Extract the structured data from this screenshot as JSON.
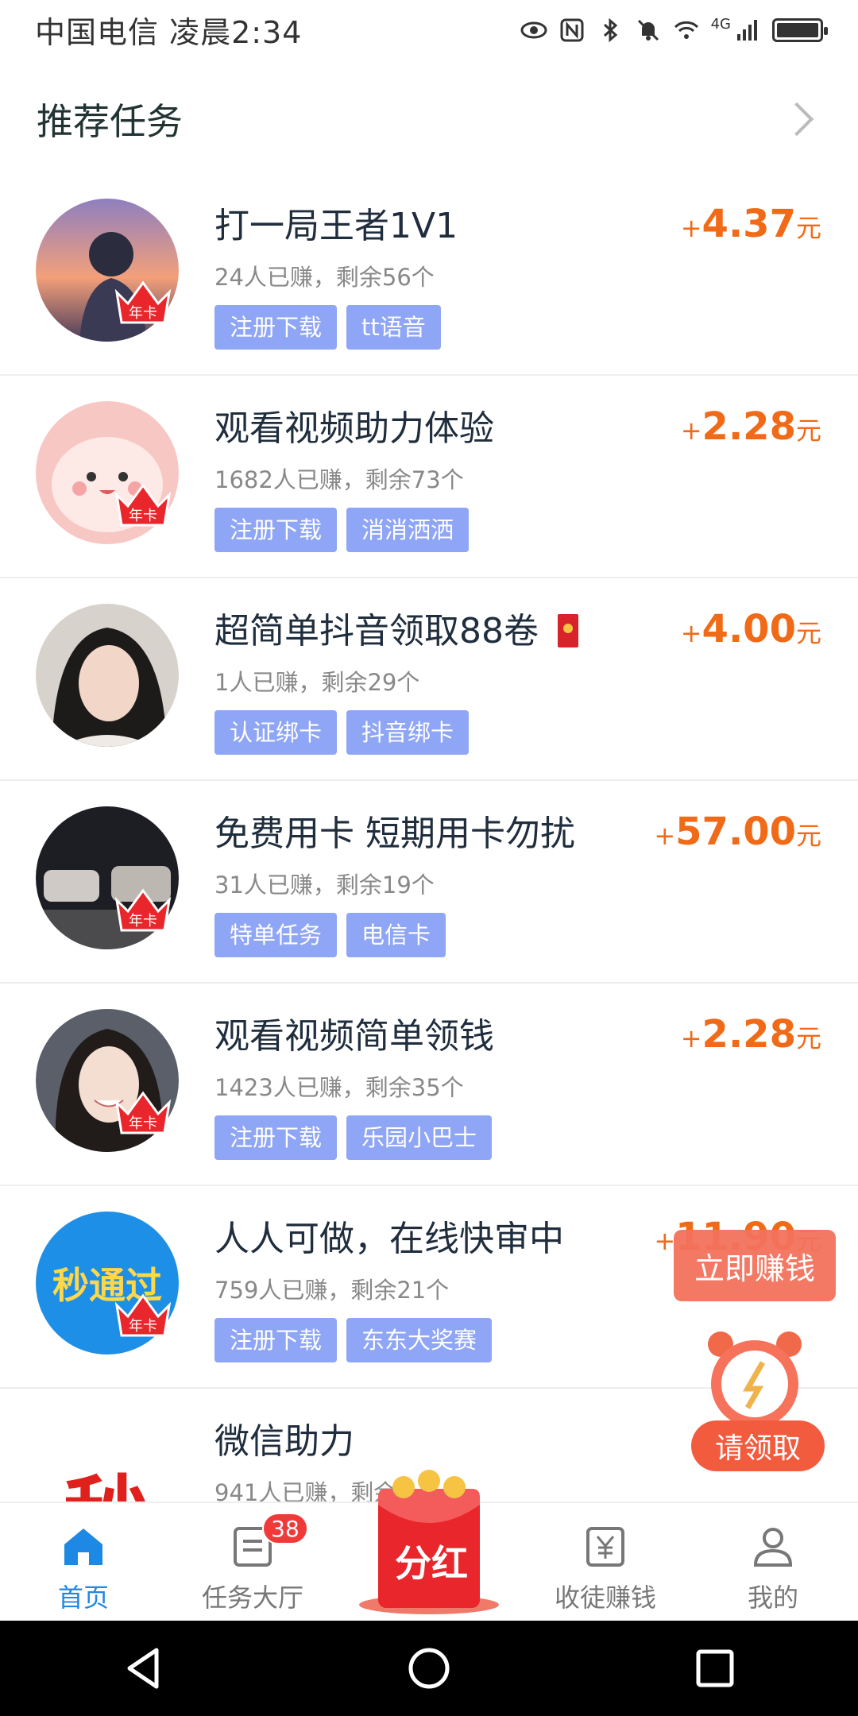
{
  "status_bar": {
    "carrier_time": "中国电信 凌晨2:34",
    "network": "4G"
  },
  "section": {
    "title": "推荐任务"
  },
  "badge_text": "年卡",
  "tasks": [
    {
      "title": "打一局王者1V1",
      "meta": "24人已赚，剩余56个",
      "tags": [
        "注册下载",
        "tt语音"
      ],
      "plus": "+",
      "amount": "4.37",
      "unit": "元",
      "has_badge": true
    },
    {
      "title": "观看视频助力体验",
      "meta": "1682人已赚，剩余73个",
      "tags": [
        "注册下载",
        "消消洒洒"
      ],
      "plus": "+",
      "amount": "2.28",
      "unit": "元",
      "has_badge": true
    },
    {
      "title": "超简单抖音领取88卷",
      "meta": "1人已赚，剩余29个",
      "tags": [
        "认证绑卡",
        "抖音绑卡"
      ],
      "plus": "+",
      "amount": "4.00",
      "unit": "元",
      "has_badge": false
    },
    {
      "title": "免费用卡 短期用卡勿扰",
      "meta": "31人已赚，剩余19个",
      "tags": [
        "特单任务",
        "电信卡"
      ],
      "plus": "+",
      "amount": "57.00",
      "unit": "元",
      "has_badge": true
    },
    {
      "title": "观看视频简单领钱",
      "meta": "1423人已赚，剩余35个",
      "tags": [
        "注册下载",
        "乐园小巴士"
      ],
      "plus": "+",
      "amount": "2.28",
      "unit": "元",
      "has_badge": true
    },
    {
      "title": "人人可做，在线快审中",
      "meta": "759人已赚，剩余21个",
      "tags": [
        "注册下载",
        "东东大奖赛"
      ],
      "plus": "+",
      "amount": "11.90",
      "unit": "元",
      "has_badge": true,
      "avatar_text": "秒通过"
    },
    {
      "title": "微信助力",
      "meta": "941人已赚，剩余",
      "tags": [],
      "plus": "",
      "amount": "",
      "unit": "",
      "has_badge": false,
      "avatar_text": "秒"
    }
  ],
  "floating": {
    "earn_now": "立即赚钱",
    "claim": "请领取"
  },
  "tabbar": {
    "home": "首页",
    "task_hall": "任务大厅",
    "task_hall_badge": "38",
    "dividend": "分红",
    "recruit": "收徒赚钱",
    "mine": "我的"
  },
  "colors": {
    "accent": "#1e88e5",
    "reward": "#f06a17",
    "tag": "#8fa5f5"
  }
}
